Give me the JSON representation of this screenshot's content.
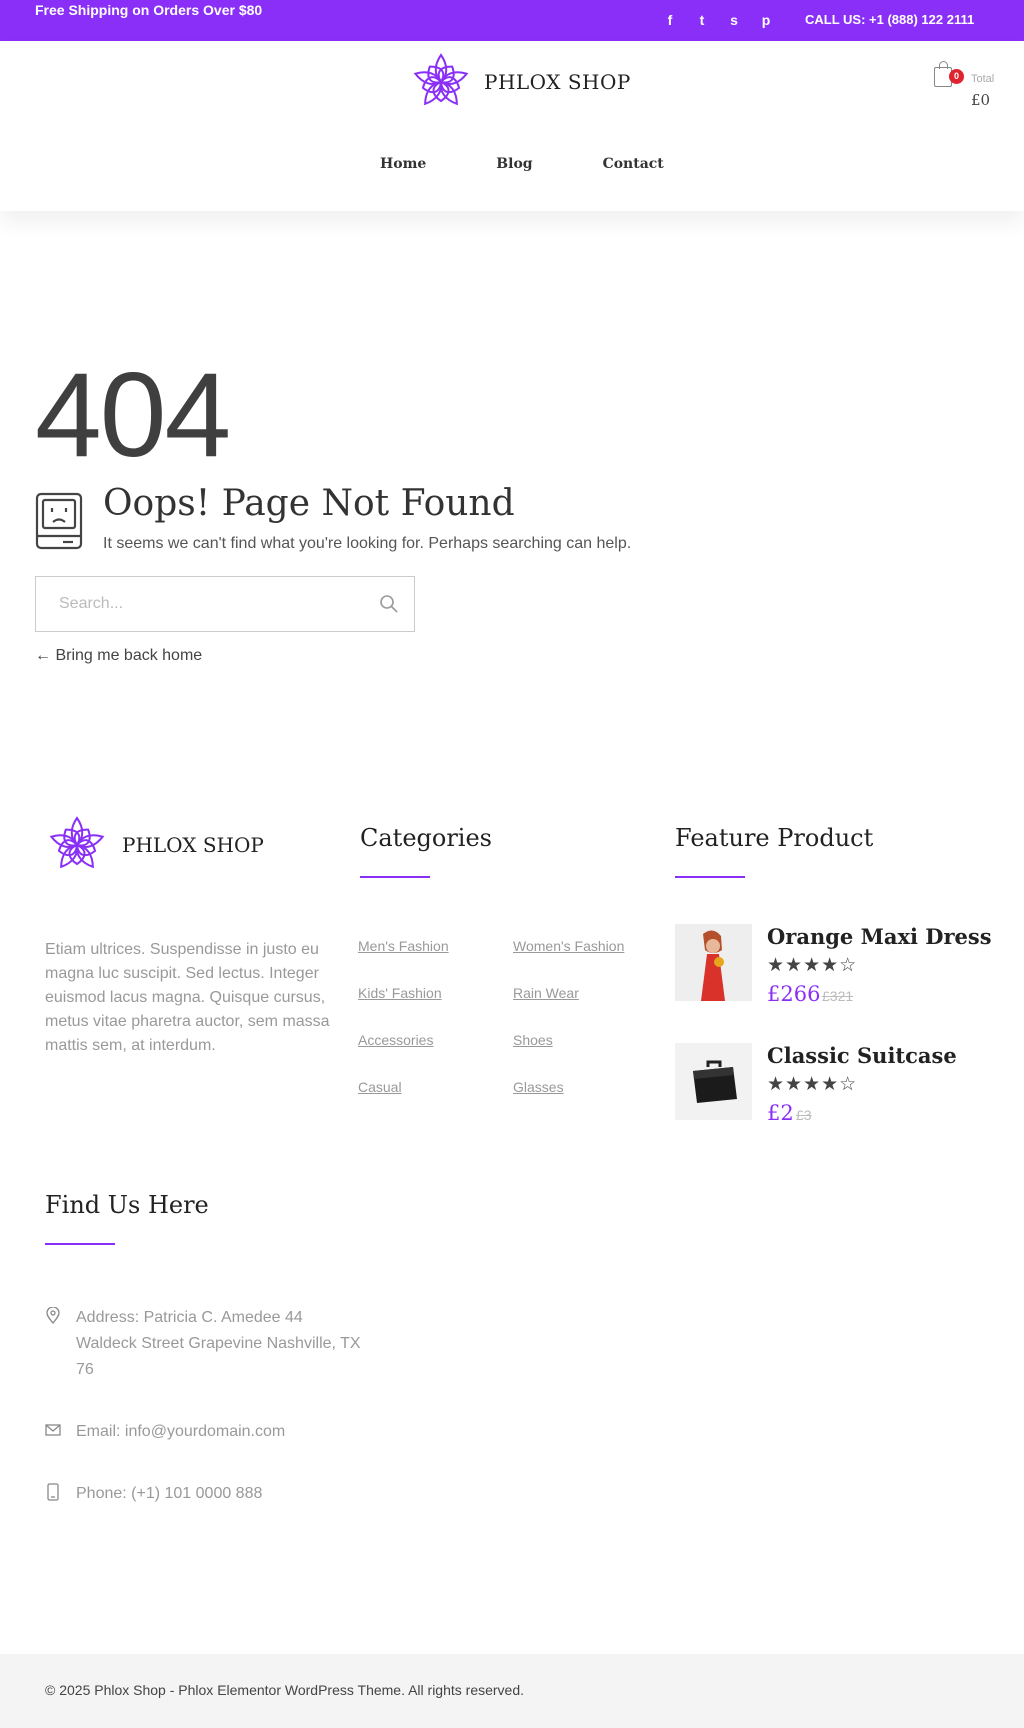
{
  "topbar": {
    "promo": "Free Shipping on Orders Over $80",
    "social": [
      {
        "icon": "facebook-icon",
        "glyph": "f"
      },
      {
        "icon": "twitter-icon",
        "glyph": "t"
      },
      {
        "icon": "skype-icon",
        "glyph": "s"
      },
      {
        "icon": "pinterest-icon",
        "glyph": "p"
      }
    ],
    "call": "CALL US: +1 (888) 122 2111"
  },
  "header": {
    "brand": "PHLOX SHOP",
    "cart": {
      "count": "0",
      "total_label": "Total",
      "total_value": "£0"
    },
    "nav": [
      "Home",
      "Blog",
      "Contact"
    ]
  },
  "error": {
    "code": "404",
    "title": "Oops! Page Not Found",
    "subtitle": "It seems we can't find what you're looking for. Perhaps searching can help.",
    "search_placeholder": "Search...",
    "back_link": "← Bring me back home"
  },
  "footer": {
    "brand": "PHLOX SHOP",
    "about": "Etiam ultrices. Suspendisse in justo eu magna luc suscipit. Sed lectus. Integer euismod lacus magna. Quisque cursus, metus vitae pharetra auctor, sem massa mattis sem, at interdum.",
    "categories_title": "Categories",
    "categories": [
      "Men's Fashion",
      "Women's Fashion",
      "Kids' Fashion",
      "Rain Wear",
      "Accessories",
      "Shoes",
      "Casual",
      "Glasses"
    ],
    "feature_title": "Feature Product",
    "products": [
      {
        "name": "Orange Maxi Dress",
        "rating": "★★★★☆",
        "price": "£266",
        "old_price": "£321"
      },
      {
        "name": "Classic Suitcase",
        "rating": "★★★★☆",
        "price": "£2",
        "old_price": "£3"
      }
    ],
    "find_title": "Find Us Here",
    "address": "Address: Patricia C. Amedee 44 Waldeck Street Grapevine Nashville, TX 76",
    "email": "Email: info@yourdomain.com",
    "phone": "Phone: (+1) 101 0000 888",
    "copyright": "© 2025 Phlox Shop - Phlox Elementor WordPress Theme. All rights reserved."
  },
  "colors": {
    "accent": "#8a2ff7",
    "badge": "#e0242f"
  }
}
